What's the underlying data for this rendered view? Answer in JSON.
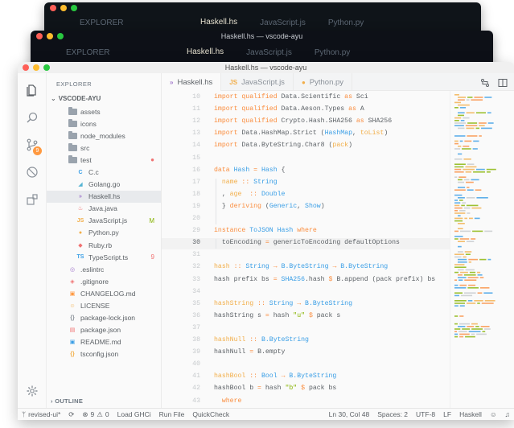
{
  "background_windows": [
    {
      "tabs": [
        {
          "label": "EXPLORER"
        },
        {
          "label": "Haskell.hs",
          "active": true
        },
        {
          "label": "JavaScript.js"
        },
        {
          "label": "Python.py"
        }
      ]
    },
    {
      "title": "Haskell.hs — vscode-ayu",
      "tabs": [
        {
          "label": "EXPLORER"
        },
        {
          "label": "Haskell.hs",
          "active": true
        },
        {
          "label": "JavaScript.js"
        },
        {
          "label": "Python.py"
        }
      ]
    }
  ],
  "window": {
    "title": "Haskell.hs — vscode-ayu"
  },
  "sidebar": {
    "title": "EXPLORER",
    "root": "VSCODE-AYU",
    "items": [
      {
        "label": "assets",
        "kind": "folder",
        "depth": 1
      },
      {
        "label": "icons",
        "kind": "folder",
        "depth": 1
      },
      {
        "label": "node_modules",
        "kind": "folder",
        "depth": 1
      },
      {
        "label": "src",
        "kind": "folder",
        "depth": 1
      },
      {
        "label": "test",
        "kind": "folder",
        "depth": 1,
        "status_color": "#f07171"
      },
      {
        "label": "C.c",
        "kind": "file",
        "depth": 2,
        "glyph": "C",
        "color": "#399ee6"
      },
      {
        "label": "Golang.go",
        "kind": "file",
        "depth": 2,
        "glyph": "◢",
        "color": "#55b4d4"
      },
      {
        "label": "Haskell.hs",
        "kind": "file",
        "depth": 2,
        "glyph": "»",
        "color": "#a37acc",
        "active": true
      },
      {
        "label": "Java.java",
        "kind": "file",
        "depth": 2,
        "glyph": "♨",
        "color": "#f07171"
      },
      {
        "label": "JavaScript.js",
        "kind": "file",
        "depth": 2,
        "glyph": "JS",
        "color": "#f2ae49",
        "status": "M",
        "status_color": "#86b300"
      },
      {
        "label": "Python.py",
        "kind": "file",
        "depth": 2,
        "glyph": "●",
        "color": "#f2ae49"
      },
      {
        "label": "Ruby.rb",
        "kind": "file",
        "depth": 2,
        "glyph": "◆",
        "color": "#f07171"
      },
      {
        "label": "TypeScript.ts",
        "kind": "file",
        "depth": 2,
        "glyph": "TS",
        "color": "#399ee6",
        "status": "9",
        "status_color": "#f07171"
      },
      {
        "label": ".eslintrc",
        "kind": "file",
        "depth": 1,
        "glyph": "◎",
        "color": "#a37acc"
      },
      {
        "label": ".gitignore",
        "kind": "file",
        "depth": 1,
        "glyph": "◈",
        "color": "#f07171"
      },
      {
        "label": "CHANGELOG.md",
        "kind": "file",
        "depth": 1,
        "glyph": "▣",
        "color": "#ff9940"
      },
      {
        "label": "LICENSE",
        "kind": "file",
        "depth": 1,
        "glyph": "☺",
        "color": "#f2ae49"
      },
      {
        "label": "package-lock.json",
        "kind": "file",
        "depth": 1,
        "glyph": "{}",
        "color": "#8a9199"
      },
      {
        "label": "package.json",
        "kind": "file",
        "depth": 1,
        "glyph": "▤",
        "color": "#f07171"
      },
      {
        "label": "README.md",
        "kind": "file",
        "depth": 1,
        "glyph": "▣",
        "color": "#399ee6"
      },
      {
        "label": "tsconfig.json",
        "kind": "file",
        "depth": 1,
        "glyph": "{}",
        "color": "#f2ae49"
      }
    ],
    "outline_label": "OUTLINE"
  },
  "activity_badge": "9",
  "tabs": [
    {
      "label": "Haskell.hs",
      "glyph": "»",
      "color": "#a37acc",
      "active": true
    },
    {
      "label": "JavaScript.js",
      "glyph": "JS",
      "color": "#f2ae49"
    },
    {
      "label": "Python.py",
      "glyph": "●",
      "color": "#f2ae49"
    }
  ],
  "editor": {
    "current_line": "30",
    "lines": [
      {
        "n": "10",
        "tokens": [
          [
            "k",
            "import qualified "
          ],
          [
            "",
            "Data.Scientific "
          ],
          [
            "k",
            "as "
          ],
          [
            "",
            "Sci"
          ]
        ]
      },
      {
        "n": "11",
        "tokens": [
          [
            "k",
            "import qualified "
          ],
          [
            "",
            "Data.Aeson.Types "
          ],
          [
            "k",
            "as "
          ],
          [
            "",
            "A"
          ]
        ]
      },
      {
        "n": "12",
        "tokens": [
          [
            "k",
            "import qualified "
          ],
          [
            "",
            "Crypto.Hash.SHA256 "
          ],
          [
            "k",
            "as "
          ],
          [
            "",
            "SHA256"
          ]
        ]
      },
      {
        "n": "13",
        "tokens": [
          [
            "k",
            "import "
          ],
          [
            "",
            "Data.HashMap.Strict ("
          ],
          [
            "t",
            "HashMap"
          ],
          [
            "",
            ", "
          ],
          [
            "fn",
            "toList"
          ],
          [
            "",
            ")"
          ]
        ]
      },
      {
        "n": "14",
        "tokens": [
          [
            "k",
            "import "
          ],
          [
            "",
            "Data.ByteString.Char8 ("
          ],
          [
            "fn",
            "pack"
          ],
          [
            "",
            ")"
          ]
        ]
      },
      {
        "n": "15",
        "tokens": []
      },
      {
        "n": "16",
        "tokens": [
          [
            "k",
            "data "
          ],
          [
            "t",
            "Hash "
          ],
          [
            "k",
            "= "
          ],
          [
            "t",
            "Hash "
          ],
          [
            "",
            "{"
          ]
        ]
      },
      {
        "n": "17",
        "tokens": [
          [
            "",
            "  "
          ],
          [
            "fn",
            "name "
          ],
          [
            "k",
            ":: "
          ],
          [
            "t",
            "String"
          ]
        ]
      },
      {
        "n": "18",
        "tokens": [
          [
            "",
            "  , "
          ],
          [
            "fn",
            "age  "
          ],
          [
            "k",
            ":: "
          ],
          [
            "t",
            "Double"
          ]
        ]
      },
      {
        "n": "19",
        "tokens": [
          [
            "",
            "  } "
          ],
          [
            "k",
            "deriving "
          ],
          [
            "",
            "("
          ],
          [
            "t",
            "Generic"
          ],
          [
            "",
            ", "
          ],
          [
            "t",
            "Show"
          ],
          [
            "",
            ")"
          ]
        ]
      },
      {
        "n": "20",
        "tokens": []
      },
      {
        "n": "29",
        "tokens": [
          [
            "k",
            "instance "
          ],
          [
            "t",
            "ToJSON Hash "
          ],
          [
            "k",
            "where"
          ]
        ]
      },
      {
        "n": "30",
        "tokens": [
          [
            "",
            "  toEncoding "
          ],
          [
            "k",
            "= "
          ],
          [
            "",
            "genericToEncoding defaultOptions"
          ]
        ]
      },
      {
        "n": "31",
        "tokens": []
      },
      {
        "n": "32",
        "tokens": [
          [
            "fn",
            "hash "
          ],
          [
            "k",
            ":: "
          ],
          [
            "t",
            "String "
          ],
          [
            "k",
            "→ "
          ],
          [
            "t",
            "B.ByteString "
          ],
          [
            "k",
            "→ "
          ],
          [
            "t",
            "B.ByteString"
          ]
        ]
      },
      {
        "n": "33",
        "tokens": [
          [
            "",
            "hash prefix bs "
          ],
          [
            "k",
            "= "
          ],
          [
            "t",
            "SHA256"
          ],
          [
            "",
            ".hash "
          ],
          [
            "k",
            "$ "
          ],
          [
            "",
            "B.append (pack prefix) bs"
          ]
        ]
      },
      {
        "n": "34",
        "tokens": []
      },
      {
        "n": "35",
        "tokens": [
          [
            "fn",
            "hashString "
          ],
          [
            "k",
            ":: "
          ],
          [
            "t",
            "String "
          ],
          [
            "k",
            "→ "
          ],
          [
            "t",
            "B.ByteString"
          ]
        ]
      },
      {
        "n": "36",
        "tokens": [
          [
            "",
            "hashString s "
          ],
          [
            "k",
            "= "
          ],
          [
            "",
            "hash "
          ],
          [
            "s",
            "\"u\" "
          ],
          [
            "k",
            "$ "
          ],
          [
            "",
            "pack s"
          ]
        ]
      },
      {
        "n": "37",
        "tokens": []
      },
      {
        "n": "38",
        "tokens": [
          [
            "fn",
            "hashNull "
          ],
          [
            "k",
            ":: "
          ],
          [
            "t",
            "B.ByteString"
          ]
        ]
      },
      {
        "n": "39",
        "tokens": [
          [
            "",
            "hashNull "
          ],
          [
            "k",
            "= "
          ],
          [
            "",
            "B.empty"
          ]
        ]
      },
      {
        "n": "40",
        "tokens": []
      },
      {
        "n": "41",
        "tokens": [
          [
            "fn",
            "hashBool "
          ],
          [
            "k",
            ":: "
          ],
          [
            "t",
            "Bool "
          ],
          [
            "k",
            "→ "
          ],
          [
            "t",
            "B.ByteString"
          ]
        ]
      },
      {
        "n": "42",
        "tokens": [
          [
            "",
            "hashBool b "
          ],
          [
            "k",
            "= "
          ],
          [
            "",
            "hash "
          ],
          [
            "s",
            "\"b\" "
          ],
          [
            "k",
            "$ "
          ],
          [
            "",
            "pack bs"
          ]
        ]
      },
      {
        "n": "43",
        "tokens": [
          [
            "",
            "  "
          ],
          [
            "k",
            "where"
          ]
        ]
      }
    ]
  },
  "statusbar": {
    "branch": "revised-ui*",
    "problems": "9",
    "warnings": "0",
    "items": [
      "Load GHCi",
      "Run File",
      "QuickCheck"
    ],
    "position": "Ln 30, Col 48",
    "spaces": "Spaces: 2",
    "encoding": "UTF-8",
    "eol": "LF",
    "language": "Haskell"
  },
  "colors": {
    "accent": "#ff9940",
    "keyword": "#fa8d3e",
    "type": "#399ee6",
    "string": "#86b300",
    "function": "#f2ae49",
    "background": "#fafafa",
    "dark_background": "#0f1419"
  }
}
